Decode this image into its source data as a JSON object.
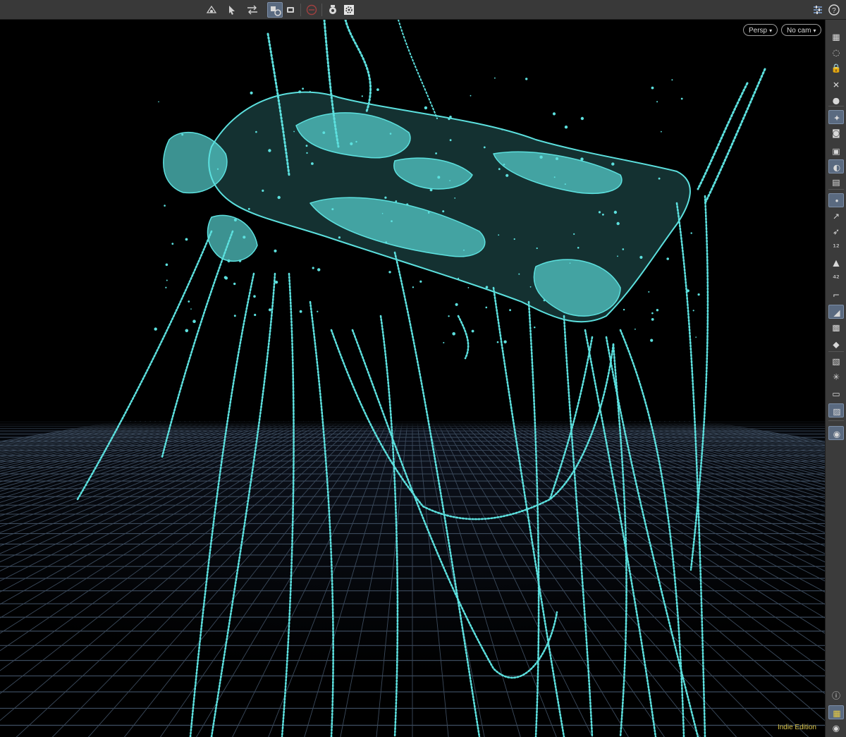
{
  "top_toolbar": {
    "tools": [
      {
        "name": "view-tool-icon"
      },
      {
        "name": "select-tool-icon"
      },
      {
        "name": "transform-tool-icon"
      },
      {
        "name": "snapping-icon"
      },
      {
        "name": "display-options-icon"
      },
      {
        "name": "disabled-tool-icon"
      },
      {
        "name": "render-icon"
      },
      {
        "name": "settings-icon"
      }
    ],
    "right_icons": [
      {
        "name": "display-settings-icon"
      },
      {
        "name": "help-icon"
      }
    ]
  },
  "viewport": {
    "camera_mode": "Persp",
    "camera_name": "No cam",
    "edition_label": "Indie Edition",
    "particle_color": "#5ce0de",
    "grid_color": "#3b4a5c"
  },
  "right_toolbar": {
    "tools": [
      "wireframe-icon",
      "ghost-icon",
      "lock-icon",
      "remove-icon",
      "sphere-icon",
      "light-icon",
      "camera-icon",
      "snapshot-icon",
      "visibility-icon",
      "flipbook-icon",
      "point-display-icon",
      "normal-icon",
      "vector-icon",
      "point-number-icon",
      "primitive-display-icon",
      "primitive-number-icon",
      "uv-boundary-icon",
      "shaded-icon",
      "texture-icon",
      "geometry-icon",
      "shading-mode-icon",
      "lighting-icon",
      "background-icon",
      "background-image-icon",
      "marker-icon"
    ],
    "bottom_tools": [
      "info-icon",
      "layout-icon",
      "eye-icon"
    ]
  }
}
